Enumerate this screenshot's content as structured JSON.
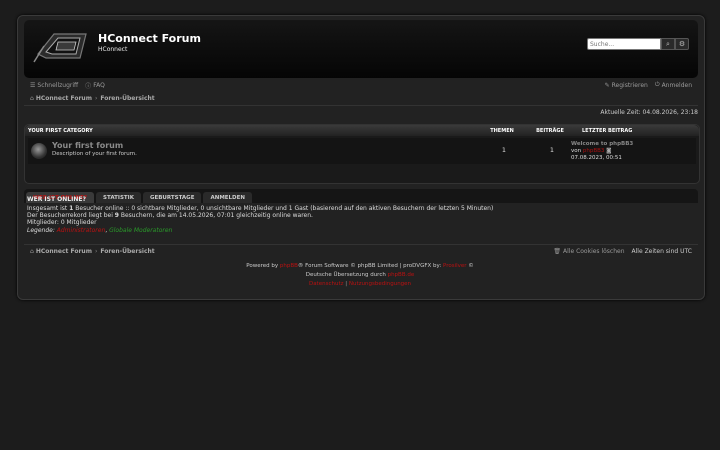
{
  "site": {
    "title": "HConnect Forum",
    "description": "HConnect"
  },
  "search": {
    "placeholder": "Suche..."
  },
  "nav": {
    "quicklinks": "Schnellzugriff",
    "faq": "FAQ",
    "register": "Registrieren",
    "login": "Anmelden"
  },
  "breadcrumb": {
    "home": "HConnect Forum",
    "index": "Foren-Übersicht",
    "sep": "›"
  },
  "time": "Aktuelle Zeit: 04.08.2026, 23:18",
  "table": {
    "header": {
      "category": "Your first category",
      "topics": "Themen",
      "posts": "Beiträge",
      "last": "Letzter Beitrag"
    },
    "forum": {
      "name": "Your first forum",
      "desc": "Description of your first forum.",
      "topics": "1",
      "posts": "1",
      "last_title": "Welcome to phpBB3",
      "last_by": "von",
      "last_user": "phpBB3",
      "last_date": "07.08.2023, 00:51"
    }
  },
  "tabs": [
    "WER IST ONLINE?",
    "STATISTIK",
    "GEBURTSTAGE",
    "ANMELDEN"
  ],
  "online": {
    "title": "WER IST ONLINE?",
    "line1_a": "Insgesamt ist ",
    "line1_b": "1",
    "line1_c": " Besucher online :: 0 sichtbare Mitglieder, 0 unsichtbare Mitglieder und 1 Gast (basierend auf den aktiven Besuchern der letzten 5 Minuten)",
    "line2_a": "Der Besucherrekord liegt bei ",
    "line2_b": "9",
    "line2_c": " Besuchern, die am 14.05.2026, 07:01 gleichzeitig online waren.",
    "line3": "Mitglieder: 0 Mitglieder",
    "legend_label": "Legende: ",
    "legend_admins": "Administratoren",
    "legend_comma": ", ",
    "legend_mods": "Globale Moderatoren"
  },
  "footer": {
    "delete_cookies": "Alle Cookies löschen",
    "timezone": "Alle Zeiten sind UTC"
  },
  "copyright": {
    "powered_a": "Powered by ",
    "powered_link": "phpBB",
    "powered_b": "® Forum Software © phpBB Limited | proDVGFX by: ",
    "author_link": "Prosilver",
    "powered_c": " ©",
    "translation_a": "Deutsche Übersetzung durch ",
    "translation_link": "phpBB.de",
    "privacy": "Datenschutz",
    "pipe": "|",
    "terms": "Nutzungsbedingungen"
  },
  "colors": {
    "accent": "#b11111",
    "background": "#1c1c1c",
    "panel": "#222222"
  }
}
